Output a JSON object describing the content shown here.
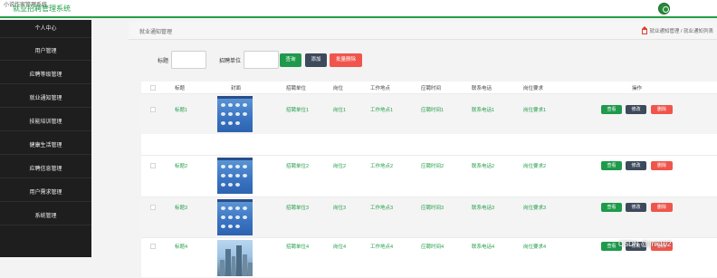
{
  "window": {
    "system_line": "小说作家管理系统",
    "brand": "就业招聘管理系统"
  },
  "sidebar": {
    "items": [
      {
        "label": "个人中心"
      },
      {
        "label": "用户管理"
      },
      {
        "label": "应聘等级管理"
      },
      {
        "label": "就业通知管理"
      },
      {
        "label": "技能培训管理"
      },
      {
        "label": "健康生活管理"
      },
      {
        "label": "应聘信息管理"
      },
      {
        "label": "用户需求管理"
      },
      {
        "label": "系统管理"
      }
    ]
  },
  "breadcrumb": {
    "title": "就业通知管理",
    "trail": "就业通知管理 / 就业通知列表"
  },
  "search": {
    "title_label": "标题",
    "title_value": "",
    "company_label": "招聘单位",
    "company_value": "",
    "query_button": "查询",
    "add_button": "添加",
    "batch_delete_button": "批量删除"
  },
  "table": {
    "headers": [
      "标题",
      "封面",
      "招聘单位",
      "岗位",
      "工作地点",
      "应聘时间",
      "联系电话",
      "岗位要求",
      "操作"
    ],
    "rows": [
      {
        "title": "标题1",
        "company": "招聘单位1",
        "position": "岗位1",
        "location": "工作地点1",
        "time": "应聘时间1",
        "phone": "联系电话1",
        "requirement": "岗位要求1",
        "cover": "phone-screenshot"
      },
      {
        "title": "标题2",
        "company": "招聘单位2",
        "position": "岗位2",
        "location": "工作地点2",
        "time": "应聘时间2",
        "phone": "联系电话2",
        "requirement": "岗位要求2",
        "cover": "phone-screenshot"
      },
      {
        "title": "标题3",
        "company": "招聘单位3",
        "position": "岗位3",
        "location": "工作地点3",
        "time": "应聘时间3",
        "phone": "联系电话3",
        "requirement": "岗位要求3",
        "cover": "phone-screenshot"
      },
      {
        "title": "标题4",
        "company": "招聘单位4",
        "position": "岗位4",
        "location": "工作地点4",
        "time": "应聘时间4",
        "phone": "联系电话4",
        "requirement": "岗位要求4",
        "cover": "city-skyline"
      }
    ],
    "actions": {
      "view": "查看",
      "edit": "修改",
      "delete": "删除"
    }
  },
  "watermark": "CSDN @jink102",
  "colors": {
    "accent": "#239e4a",
    "danger": "#f0554b",
    "dark": "#3d4a5c",
    "sidebar": "#1e1e1e"
  }
}
